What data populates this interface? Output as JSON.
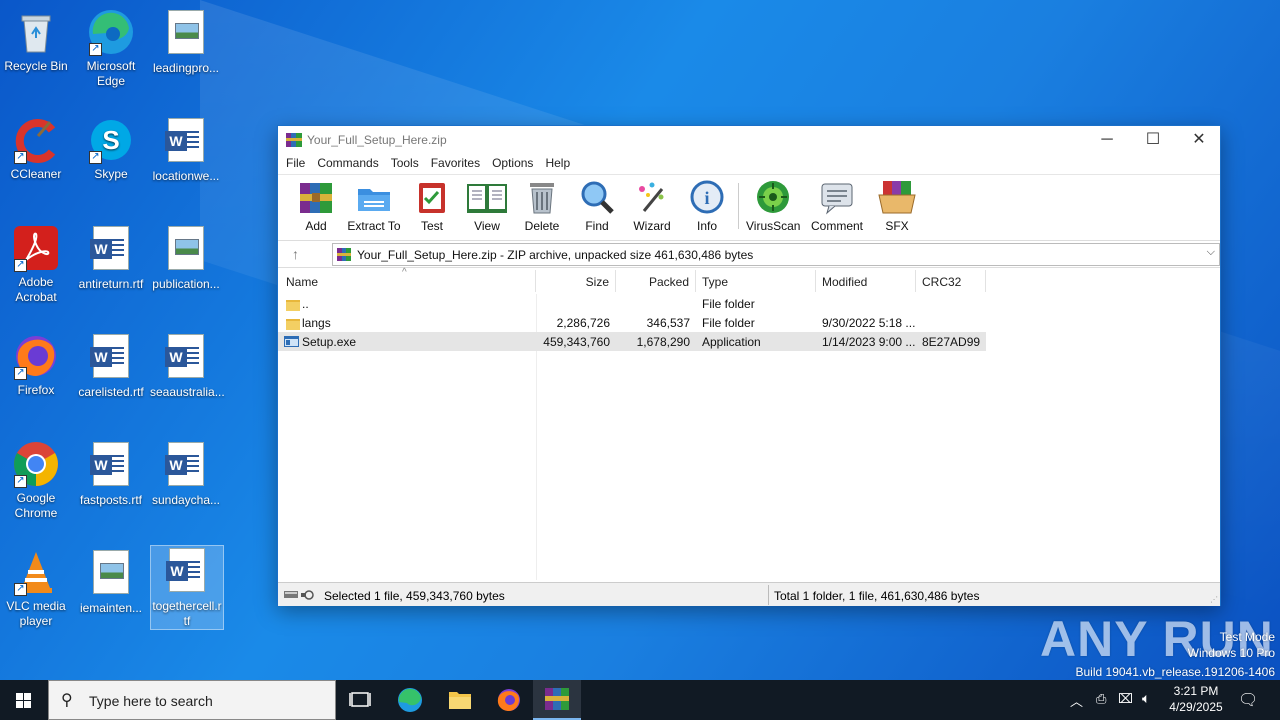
{
  "desktop": {
    "icons": [
      {
        "label": "Recycle Bin"
      },
      {
        "label": "Microsoft Edge"
      },
      {
        "label": "leadingpro..."
      },
      {
        "label": "CCleaner"
      },
      {
        "label": "Skype"
      },
      {
        "label": "locationwe..."
      },
      {
        "label": "Adobe Acrobat"
      },
      {
        "label": "antireturn.rtf"
      },
      {
        "label": "publication..."
      },
      {
        "label": "Firefox"
      },
      {
        "label": "carelisted.rtf"
      },
      {
        "label": "seaaustralia..."
      },
      {
        "label": "Google Chrome"
      },
      {
        "label": "fastposts.rtf"
      },
      {
        "label": "sundaycha..."
      },
      {
        "label": "VLC media player"
      },
      {
        "label": "iemainten..."
      },
      {
        "label": "togethercell.rtf"
      }
    ]
  },
  "window": {
    "title": "Your_Full_Setup_Here.zip",
    "menu": [
      "File",
      "Commands",
      "Tools",
      "Favorites",
      "Options",
      "Help"
    ],
    "toolbar": [
      "Add",
      "Extract To",
      "Test",
      "View",
      "Delete",
      "Find",
      "Wizard",
      "Info",
      "VirusScan",
      "Comment",
      "SFX"
    ],
    "address": "Your_Full_Setup_Here.zip - ZIP archive, unpacked size 461,630,486 bytes",
    "columns": [
      "Name",
      "Size",
      "Packed",
      "Type",
      "Modified",
      "CRC32"
    ],
    "rows": [
      {
        "name": "..",
        "size": "",
        "packed": "",
        "type": "File folder",
        "modified": "",
        "crc": ""
      },
      {
        "name": "langs",
        "size": "2,286,726",
        "packed": "346,537",
        "type": "File folder",
        "modified": "9/30/2022 5:18 ...",
        "crc": ""
      },
      {
        "name": "Setup.exe",
        "size": "459,343,760",
        "packed": "1,678,290",
        "type": "Application",
        "modified": "1/14/2023 9:00 ...",
        "crc": "8E27AD99"
      }
    ],
    "status_left": "Selected 1 file, 459,343,760 bytes",
    "status_right": "Total 1 folder, 1 file, 461,630,486 bytes"
  },
  "watermark": {
    "brand": "ANY RUN",
    "line1": "Test Mode",
    "line2": "Windows 10 Pro",
    "line3": "Build 19041.vb_release.191206-1406"
  },
  "taskbar": {
    "search_placeholder": "Type here to search",
    "time": "3:21 PM",
    "date": "4/29/2025"
  }
}
